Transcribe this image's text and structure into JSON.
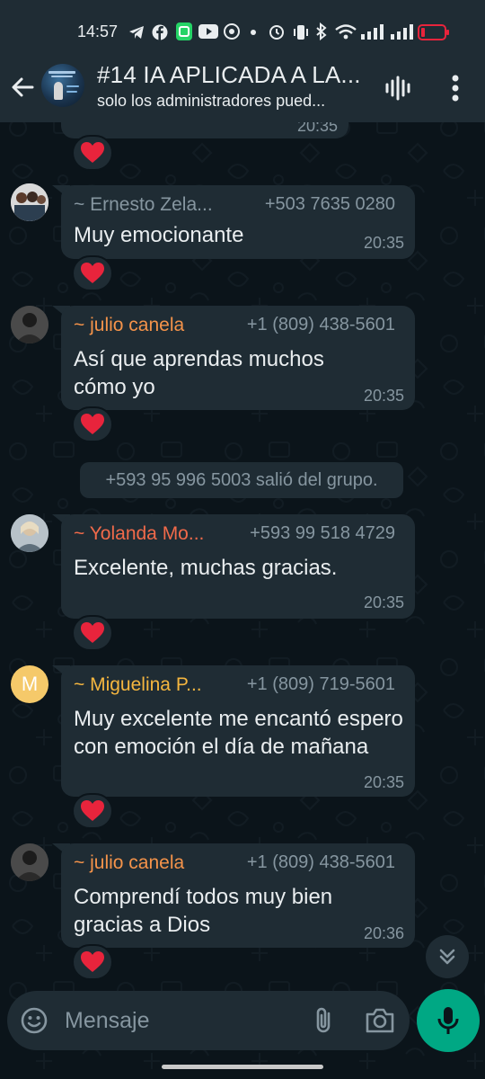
{
  "status_bar": {
    "time": "14:57",
    "icons": [
      "telegram-icon",
      "facebook-icon",
      "app-icon",
      "youtube-icon",
      "chrome-icon",
      "dot-icon",
      "alarm-icon",
      "vibrate-icon",
      "bluetooth-icon",
      "wifi-icon",
      "signal-icon",
      "signal-icon",
      "battery-low-icon"
    ]
  },
  "header": {
    "title": "#14 IA APLICADA A LA...",
    "subtitle": "solo los administradores pued..."
  },
  "previous_message": {
    "time": "20:35"
  },
  "messages": [
    {
      "sender": "~ Ernesto Zela...",
      "phone": "+503 7635 0280",
      "text": "Muy emocionante",
      "time": "20:35",
      "reaction": "❤️",
      "sender_color": "#8696a0"
    },
    {
      "sender": "~ julio canela",
      "phone": "+1 (809) 438-5601",
      "text": "Así que aprendas muchos cómo yo",
      "time": "20:35",
      "reaction": "❤️",
      "sender_color": "#f4934a"
    },
    {
      "sender": "~ Yolanda Mo...",
      "phone": "+593 99 518 4729",
      "text": "Excelente, muchas gracias.",
      "time": "20:35",
      "reaction": "❤️",
      "sender_color": "#f16a4a"
    },
    {
      "sender": "~ Miguelina P...",
      "phone": "+1 (809) 719-5601",
      "text": "Muy excelente me encantó espero  con emoción el día de mañana",
      "time": "20:35",
      "reaction": "❤️",
      "sender_color": "#f5b63f",
      "avatar_letter": "M"
    },
    {
      "sender": "~ julio canela",
      "phone": "+1 (809) 438-5601",
      "text": "Comprendí todos muy bien gracias a Dios",
      "time": "20:36",
      "reaction": "❤️",
      "sender_color": "#f4934a"
    }
  ],
  "system_message": "+593 95 996 5003 salió del grupo.",
  "composer": {
    "placeholder": "Mensaje"
  },
  "colors": {
    "background": "#0b141a",
    "bubble": "#1f2c34",
    "accent": "#00a884",
    "secondary_text": "#8696a0",
    "heart": "#e8243c"
  }
}
